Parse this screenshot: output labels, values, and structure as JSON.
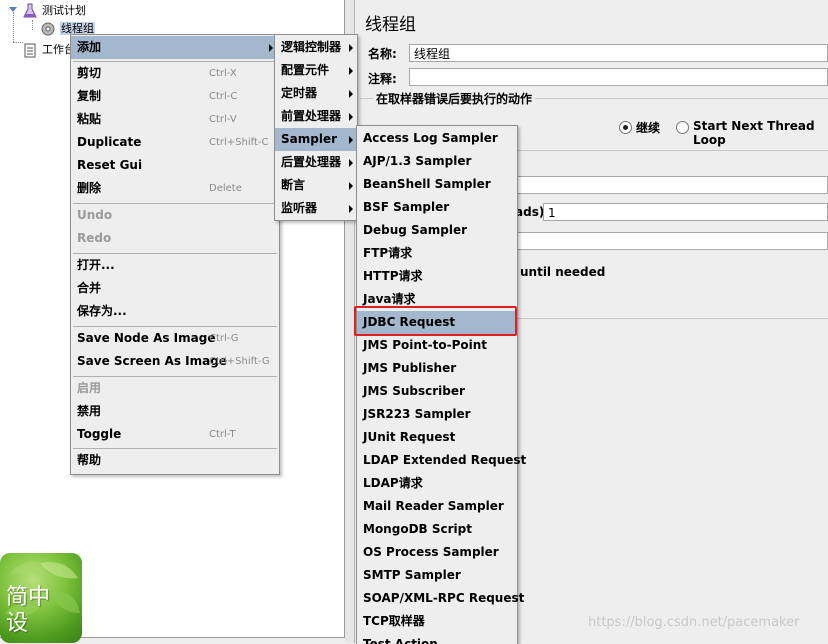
{
  "tree": {
    "test_plan": "测试计划",
    "thread_group": "线程组",
    "workbench": "工作台"
  },
  "editor": {
    "title": "线程组",
    "name_label": "名称:",
    "name_value": "线程组",
    "comment_label": "注释:",
    "error_action_heading": "在取样器错误后要执行的动作",
    "radio_continue": "继续",
    "radio_next_loop": "Start Next Thread Loop",
    "partial_label": "ads):",
    "partial_value": "1",
    "partial_text": "until needed"
  },
  "context_menu": {
    "items": [
      {
        "label": "添加",
        "accel": ""
      },
      {
        "label": "剪切",
        "accel": "Ctrl-X"
      },
      {
        "label": "复制",
        "accel": "Ctrl-C"
      },
      {
        "label": "粘贴",
        "accel": "Ctrl-V"
      },
      {
        "label": "Duplicate",
        "accel": "Ctrl+Shift-C"
      },
      {
        "label": "Reset Gui",
        "accel": ""
      },
      {
        "label": "删除",
        "accel": "Delete"
      },
      {
        "label": "Undo",
        "accel": ""
      },
      {
        "label": "Redo",
        "accel": ""
      },
      {
        "label": "打开...",
        "accel": ""
      },
      {
        "label": "合并",
        "accel": ""
      },
      {
        "label": "保存为...",
        "accel": ""
      },
      {
        "label": "Save Node As Image",
        "accel": "Ctrl-G"
      },
      {
        "label": "Save Screen As Image",
        "accel": "Ctrl+Shift-G"
      },
      {
        "label": "启用",
        "accel": ""
      },
      {
        "label": "禁用",
        "accel": ""
      },
      {
        "label": "Toggle",
        "accel": "Ctrl-T"
      },
      {
        "label": "帮助",
        "accel": ""
      }
    ]
  },
  "add_submenu": {
    "items": [
      "逻辑控制器",
      "配置元件",
      "定时器",
      "前置处理器",
      "Sampler",
      "后置处理器",
      "断言",
      "监听器"
    ]
  },
  "sampler_submenu": {
    "items": [
      "Access Log Sampler",
      "AJP/1.3 Sampler",
      "BeanShell Sampler",
      "BSF Sampler",
      "Debug Sampler",
      "FTP请求",
      "HTTP请求",
      "Java请求",
      "JDBC Request",
      "JMS Point-to-Point",
      "JMS Publisher",
      "JMS Subscriber",
      "JSR223 Sampler",
      "JUnit Request",
      "LDAP Extended Request",
      "LDAP请求",
      "Mail Reader Sampler",
      "MongoDB Script",
      "OS Process Sampler",
      "SMTP Sampler",
      "SOAP/XML-RPC Request",
      "TCP取样器",
      "Test Action"
    ]
  },
  "logo": {
    "text": "简中设"
  },
  "watermark": "https://blog.csdn.net/pacemaker",
  "colors": {
    "menu_highlight": "#a3b8cc",
    "red_box": "#e02020"
  }
}
